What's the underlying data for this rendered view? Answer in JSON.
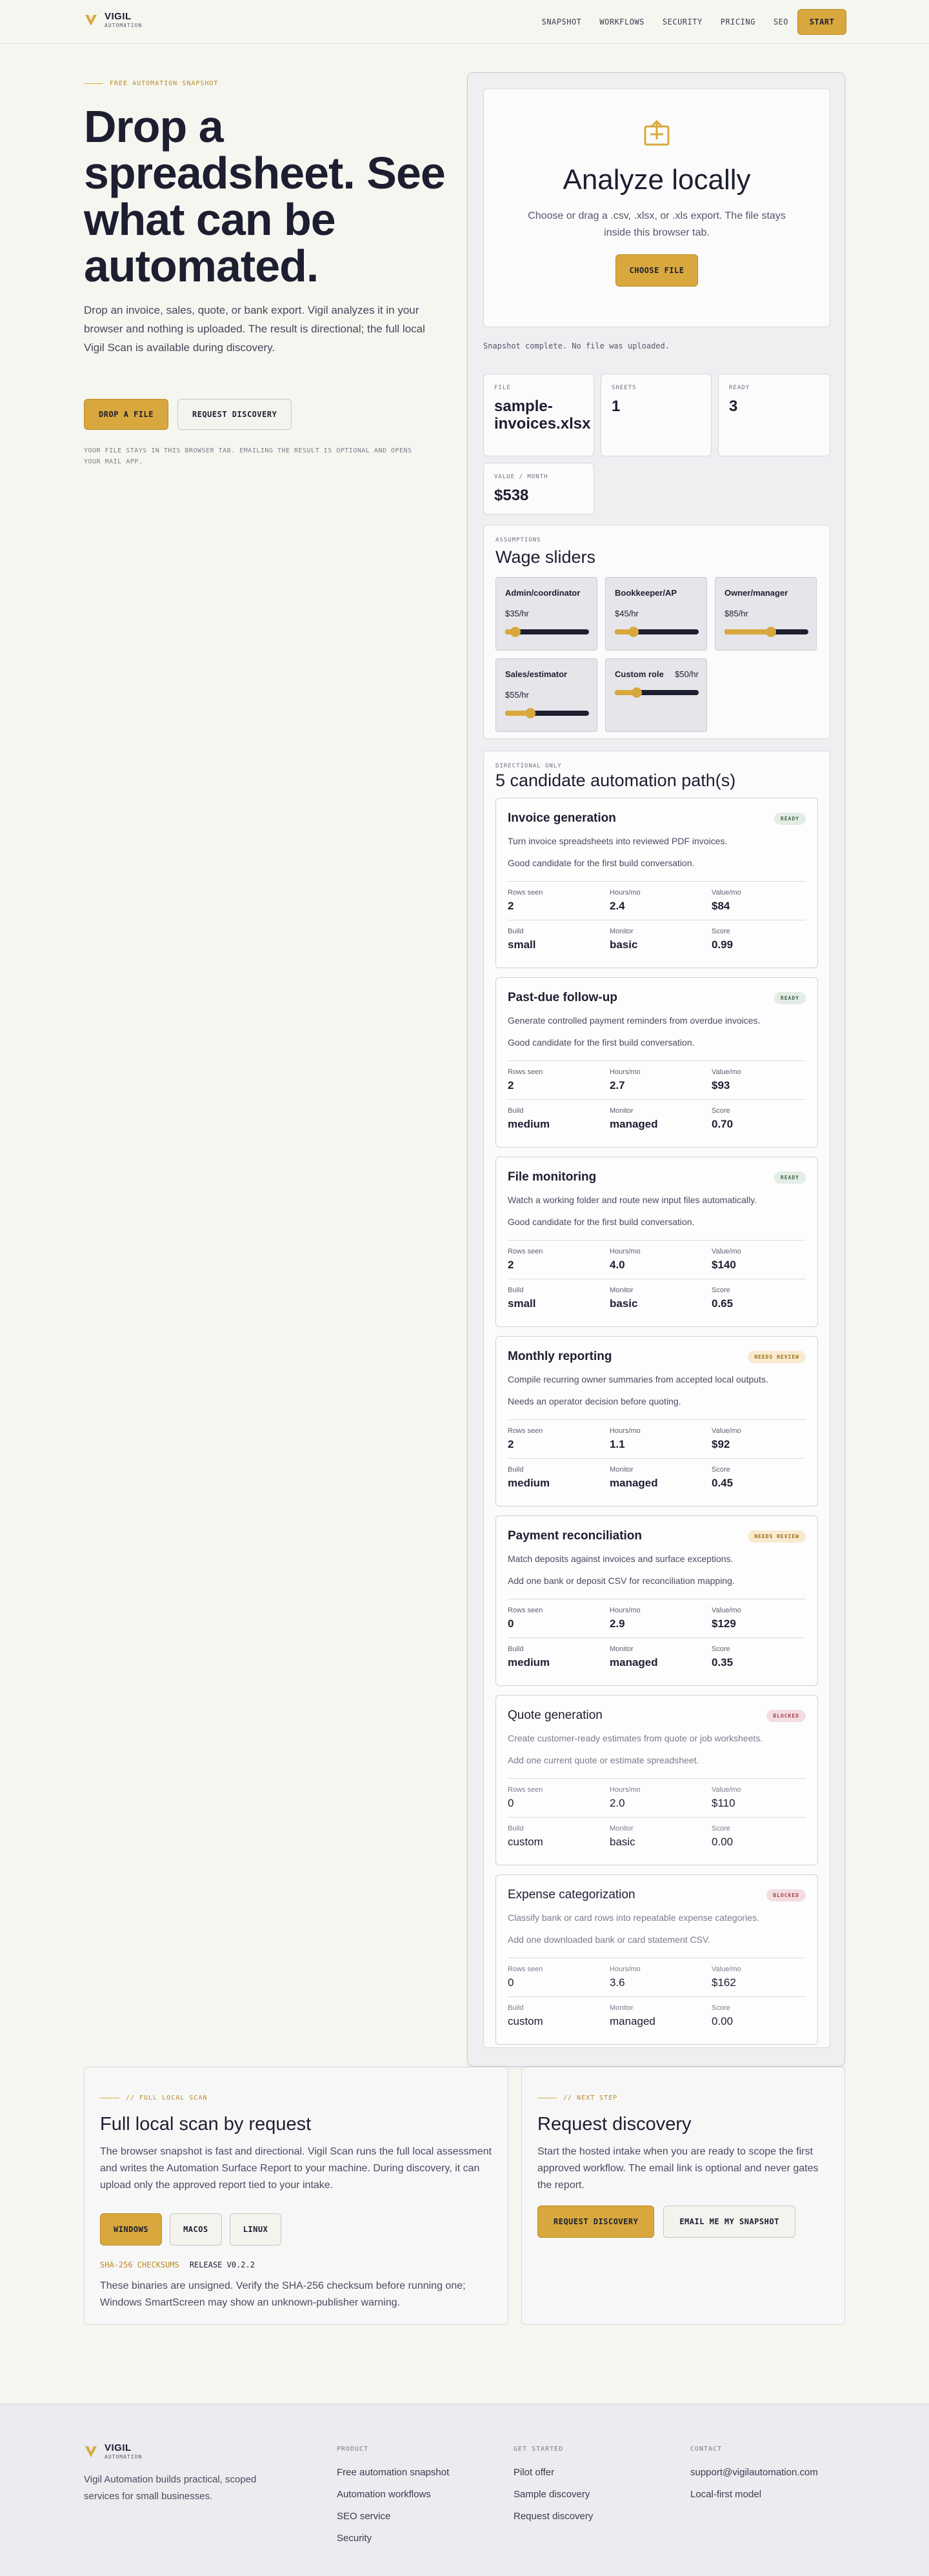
{
  "header": {
    "brand": "VIGIL",
    "brand_sub": "AUTOMATION",
    "nav": [
      "SNAPSHOT",
      "WORKFLOWS",
      "SECURITY",
      "PRICING",
      "SEO"
    ],
    "start_label": "START"
  },
  "hero": {
    "eyebrow": "FREE AUTOMATION SNAPSHOT",
    "title": "Drop a spreadsheet. See what can be automated.",
    "lead": "Drop an invoice, sales, quote, or bank export. Vigil analyzes it in your browser and nothing is uploaded. The result is directional; the full local Vigil Scan is available during discovery.",
    "primary_btn": "DROP A FILE",
    "secondary_btn": "REQUEST DISCOVERY",
    "note": "YOUR FILE STAYS IN THIS BROWSER TAB. EMAILING THE RESULT IS OPTIONAL AND OPENS YOUR MAIL APP."
  },
  "analyzer": {
    "icon": "upload-icon",
    "title": "Analyze locally",
    "desc": "Choose or drag a .csv, .xlsx, or .xls export. The file stays inside this browser tab.",
    "choose_btn": "CHOOSE FILE",
    "status": "Snapshot complete. No file was uploaded.",
    "stats": {
      "file": {
        "label": "FILE",
        "value": "sample-invoices.xlsx"
      },
      "sheets": {
        "label": "SHEETS",
        "value": "1"
      },
      "ready": {
        "label": "READY",
        "value": "3"
      },
      "value_month": {
        "label": "VALUE / MONTH",
        "value": "$538"
      }
    }
  },
  "wages": {
    "label": "ASSUMPTIONS",
    "title": "Wage sliders",
    "sliders": [
      {
        "name": "Admin/coordinator",
        "rate": "$35/hr",
        "level": 0.12
      },
      {
        "name": "Bookkeeper/AP",
        "rate": "$45/hr",
        "level": 0.22
      },
      {
        "name": "Owner/manager",
        "rate": "$85/hr",
        "level": 0.55
      },
      {
        "name": "Sales/estimator",
        "rate": "$55/hr",
        "level": 0.3
      },
      {
        "name": "Custom role",
        "rate": "$50/hr",
        "level": 0.26
      }
    ]
  },
  "paths": {
    "label": "DIRECTIONAL ONLY",
    "title": "5 candidate automation path(s)",
    "metric_labels": {
      "rows": "Rows seen",
      "hours": "Hours/mo",
      "value": "Value/mo",
      "build": "Build",
      "monitor": "Monitor",
      "score": "Score"
    },
    "items": [
      {
        "title": "Invoice generation",
        "badge": "READY",
        "state": "ready",
        "desc": "Turn invoice spreadsheets into reviewed PDF invoices.",
        "note": "Good candidate for the first build conversation.",
        "rows": "2",
        "hours": "2.4",
        "value": "$84",
        "build": "small",
        "monitor": "basic",
        "score": "0.99"
      },
      {
        "title": "Past-due follow-up",
        "badge": "READY",
        "state": "ready",
        "desc": "Generate controlled payment reminders from overdue invoices.",
        "note": "Good candidate for the first build conversation.",
        "rows": "2",
        "hours": "2.7",
        "value": "$93",
        "build": "medium",
        "monitor": "managed",
        "score": "0.70"
      },
      {
        "title": "File monitoring",
        "badge": "READY",
        "state": "ready",
        "desc": "Watch a working folder and route new input files automatically.",
        "note": "Good candidate for the first build conversation.",
        "rows": "2",
        "hours": "4.0",
        "value": "$140",
        "build": "small",
        "monitor": "basic",
        "score": "0.65"
      },
      {
        "title": "Monthly reporting",
        "badge": "NEEDS REVIEW",
        "state": "review",
        "desc": "Compile recurring owner summaries from accepted local outputs.",
        "note": "Needs an operator decision before quoting.",
        "rows": "2",
        "hours": "1.1",
        "value": "$92",
        "build": "medium",
        "monitor": "managed",
        "score": "0.45"
      },
      {
        "title": "Payment reconciliation",
        "badge": "NEEDS REVIEW",
        "state": "review",
        "desc": "Match deposits against invoices and surface exceptions.",
        "note": "Add one bank or deposit CSV for reconciliation mapping.",
        "rows": "0",
        "hours": "2.9",
        "value": "$129",
        "build": "medium",
        "monitor": "managed",
        "score": "0.35"
      },
      {
        "title": "Quote generation",
        "badge": "BLOCKED",
        "state": "blocked",
        "desc": "Create customer-ready estimates from quote or job worksheets.",
        "note": "Add one current quote or estimate spreadsheet.",
        "rows": "0",
        "hours": "2.0",
        "value": "$110",
        "build": "custom",
        "monitor": "basic",
        "score": "0.00"
      },
      {
        "title": "Expense categorization",
        "badge": "BLOCKED",
        "state": "blocked",
        "desc": "Classify bank or card rows into repeatable expense categories.",
        "note": "Add one downloaded bank or card statement CSV.",
        "rows": "0",
        "hours": "3.6",
        "value": "$162",
        "build": "custom",
        "monitor": "managed",
        "score": "0.00"
      }
    ]
  },
  "full_scan": {
    "eyebrow": "// FULL LOCAL SCAN",
    "title": "Full local scan by request",
    "body": "The browser snapshot is fast and directional. Vigil Scan runs the full local assessment and writes the Automation Surface Report to your machine. During discovery, it can upload only the approved report tied to your intake.",
    "buttons": [
      "WINDOWS",
      "MACOS",
      "LINUX"
    ],
    "sha_label": "SHA-256 CHECKSUMS",
    "release": "RELEASE V0.2.2",
    "warning": "These binaries are unsigned. Verify the SHA-256 checksum before running one; Windows SmartScreen may show an unknown-publisher warning."
  },
  "next_step": {
    "eyebrow": "// NEXT STEP",
    "title": "Request discovery",
    "body": "Start the hosted intake when you are ready to scope the first approved workflow. The email link is optional and never gates the report.",
    "primary_btn": "REQUEST DISCOVERY",
    "secondary_btn": "EMAIL ME MY SNAPSHOT"
  },
  "footer": {
    "brand": "VIGIL",
    "brand_sub": "AUTOMATION",
    "desc": "Vigil Automation builds practical, scoped services for small businesses.",
    "columns": [
      {
        "heading": "PRODUCT",
        "links": [
          "Free automation snapshot",
          "Automation workflows",
          "SEO service",
          "Security"
        ]
      },
      {
        "heading": "GET STARTED",
        "links": [
          "Pilot offer",
          "Sample discovery",
          "Request discovery"
        ]
      },
      {
        "heading": "CONTACT",
        "links": [
          "support@vigilautomation.com",
          "Local-first model"
        ]
      }
    ]
  },
  "colors": {
    "accent": "#d8a83e",
    "ink": "#1d1e30",
    "ready_bg": "#e3ece5",
    "review_bg": "#f8ead0",
    "blocked_bg": "#f4dde0"
  }
}
